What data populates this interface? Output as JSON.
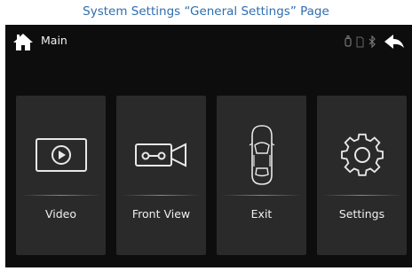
{
  "caption": "System Settings “General Settings” Page",
  "topbar": {
    "title": "Main",
    "home_icon": "home-icon",
    "status_icons": [
      "usb-icon",
      "sd-card-icon",
      "bluetooth-icon"
    ],
    "back_icon": "back-arrow-icon"
  },
  "cards": [
    {
      "label": "Video",
      "icon": "play-video-icon"
    },
    {
      "label": "Front View",
      "icon": "camera-icon"
    },
    {
      "label": "Exit",
      "icon": "car-icon"
    },
    {
      "label": "Settings",
      "icon": "gear-icon"
    }
  ],
  "colors": {
    "screen_bg": "#0d0d0d",
    "card_bg": "#2a2a2a",
    "caption_text": "#2f6db0",
    "text": "#f0f0f0"
  }
}
